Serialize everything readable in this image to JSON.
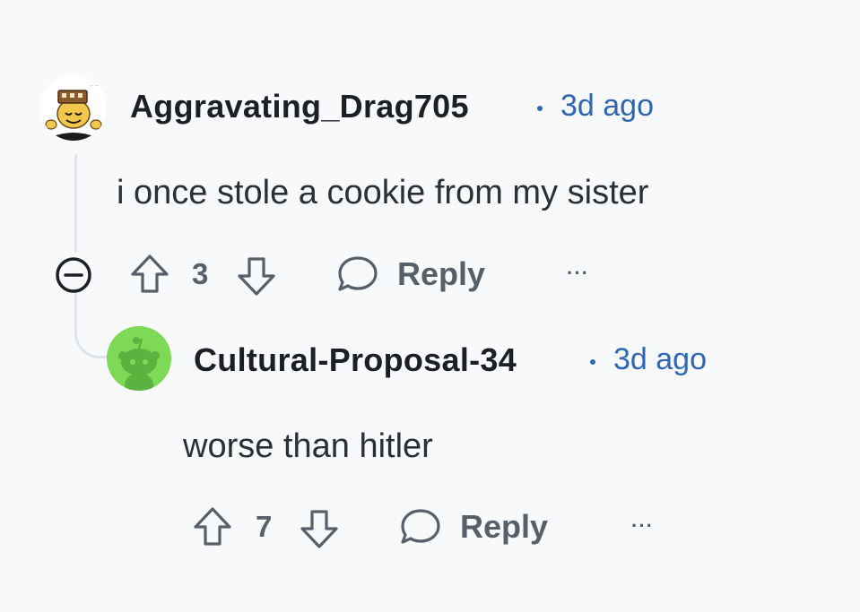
{
  "comments": [
    {
      "author": "Aggravating_Drag705",
      "time": "3d ago",
      "body": "i once stole a cookie from my sister",
      "votes": "3",
      "reply_label": "Reply",
      "more": "···",
      "avatar": "cartoon-character-avatar"
    },
    {
      "author": "Cultural-Proposal-34",
      "time": "3d ago",
      "body": "worse than hitler",
      "votes": "7",
      "reply_label": "Reply",
      "more": "···",
      "avatar": "default-green-snoo-avatar"
    }
  ],
  "colors": {
    "background": "#f8f9fb",
    "author": "#1c1f24",
    "timestamp": "#2f67b4",
    "action": "#56606b",
    "thread_line": "#dfe3ea",
    "avatar_green": "#7ed957"
  },
  "icons": [
    "collapse-icon",
    "upvote-icon",
    "downvote-icon",
    "comment-bubble-icon",
    "more-options-icon"
  ]
}
